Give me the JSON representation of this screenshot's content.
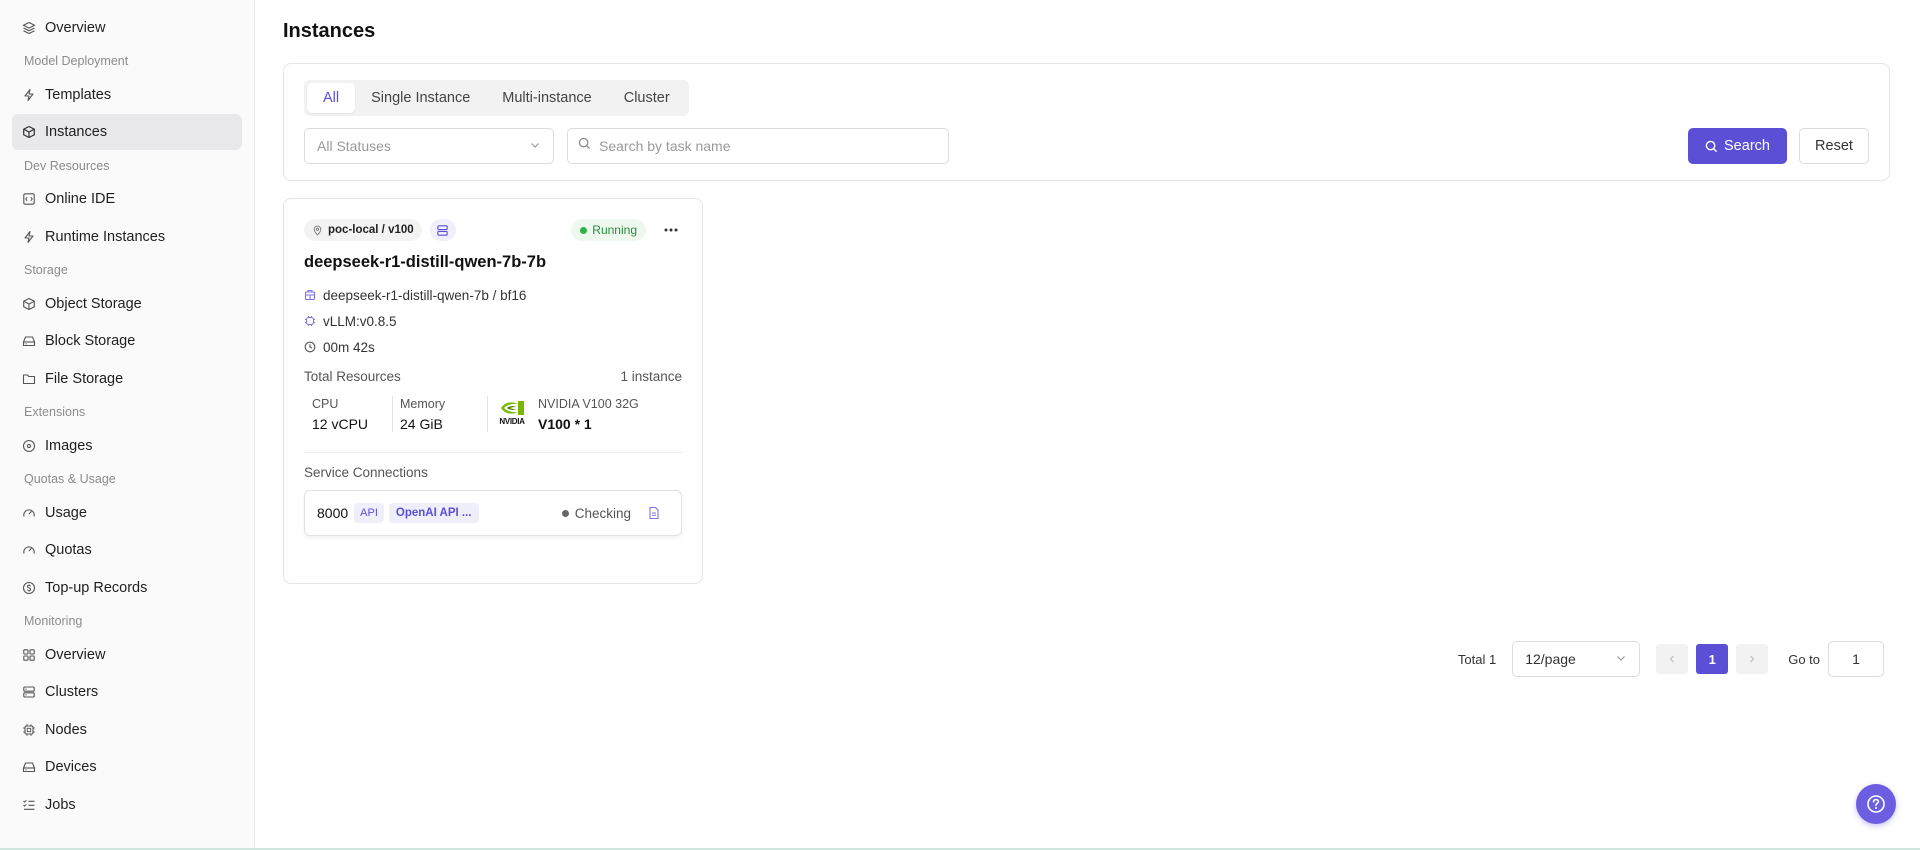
{
  "sidebar": {
    "items": [
      {
        "type": "item",
        "label": "Overview",
        "icon": "layers-icon",
        "name": "sidebar-item-overview",
        "active": false
      },
      {
        "type": "group",
        "label": "Model Deployment"
      },
      {
        "type": "item",
        "label": "Templates",
        "icon": "zap-icon",
        "name": "sidebar-item-templates",
        "active": false
      },
      {
        "type": "item",
        "label": "Instances",
        "icon": "box-icon",
        "name": "sidebar-item-instances",
        "active": true
      },
      {
        "type": "group",
        "label": "Dev Resources"
      },
      {
        "type": "item",
        "label": "Online IDE",
        "icon": "code-square-icon",
        "name": "sidebar-item-online-ide",
        "active": false
      },
      {
        "type": "item",
        "label": "Runtime Instances",
        "icon": "zap-icon",
        "name": "sidebar-item-runtime-instances",
        "active": false
      },
      {
        "type": "group",
        "label": "Storage"
      },
      {
        "type": "item",
        "label": "Object Storage",
        "icon": "cube-icon",
        "name": "sidebar-item-object-storage",
        "active": false
      },
      {
        "type": "item",
        "label": "Block Storage",
        "icon": "hard-drive-icon",
        "name": "sidebar-item-block-storage",
        "active": false
      },
      {
        "type": "item",
        "label": "File Storage",
        "icon": "folder-icon",
        "name": "sidebar-item-file-storage",
        "active": false
      },
      {
        "type": "group",
        "label": "Extensions"
      },
      {
        "type": "item",
        "label": "Images",
        "icon": "disc-icon",
        "name": "sidebar-item-images",
        "active": false
      },
      {
        "type": "group",
        "label": "Quotas & Usage"
      },
      {
        "type": "item",
        "label": "Usage",
        "icon": "gauge-icon",
        "name": "sidebar-item-usage",
        "active": false
      },
      {
        "type": "item",
        "label": "Quotas",
        "icon": "gauge-icon",
        "name": "sidebar-item-quotas",
        "active": false
      },
      {
        "type": "item",
        "label": "Top-up Records",
        "icon": "coin-icon",
        "name": "sidebar-item-top-up-records",
        "active": false
      },
      {
        "type": "group",
        "label": "Monitoring"
      },
      {
        "type": "item",
        "label": "Overview",
        "icon": "grid-icon",
        "name": "sidebar-item-monitoring-overview",
        "active": false
      },
      {
        "type": "item",
        "label": "Clusters",
        "icon": "server-icon",
        "name": "sidebar-item-clusters",
        "active": false
      },
      {
        "type": "item",
        "label": "Nodes",
        "icon": "chip-icon",
        "name": "sidebar-item-nodes",
        "active": false
      },
      {
        "type": "item",
        "label": "Devices",
        "icon": "hard-drive-icon",
        "name": "sidebar-item-devices",
        "active": false
      },
      {
        "type": "item",
        "label": "Jobs",
        "icon": "list-checks-icon",
        "name": "sidebar-item-jobs",
        "active": false
      }
    ]
  },
  "page": {
    "title": "Instances"
  },
  "filters": {
    "tabs": [
      {
        "label": "All",
        "active": true
      },
      {
        "label": "Single Instance",
        "active": false
      },
      {
        "label": "Multi-instance",
        "active": false
      },
      {
        "label": "Cluster",
        "active": false
      }
    ],
    "status_select": "All Statuses",
    "search_placeholder": "Search by task name",
    "search_label": "Search",
    "reset_label": "Reset"
  },
  "card": {
    "location": "poc-local / v100",
    "status": "Running",
    "title": "deepseek-r1-distill-qwen-7b-7b",
    "model": "deepseek-r1-distill-qwen-7b / bf16",
    "runtime": "vLLM:v0.8.5",
    "uptime": "00m 42s",
    "resources_label": "Total Resources",
    "instance_count": "1 instance",
    "cpu_label": "CPU",
    "cpu_value": "12  vCPU",
    "memory_label": "Memory",
    "memory_value": "24  GiB",
    "gpu_logo_text": "NVIDIA",
    "gpu_name": "NVIDIA V100 32G",
    "gpu_value": "V100  *  1",
    "service_label": "Service Connections",
    "service": {
      "port": "8000",
      "tag_api": "API",
      "tag_openai": "OpenAI API ...",
      "status": "Checking"
    }
  },
  "pagination": {
    "total": "Total 1",
    "page_size": "12/page",
    "current_page": "1",
    "goto_label": "Go to",
    "goto_value": "1"
  },
  "colors": {
    "accent": "#5b4fd6",
    "running": "#2fb344",
    "sidebar_active": "#e9e9ec"
  }
}
